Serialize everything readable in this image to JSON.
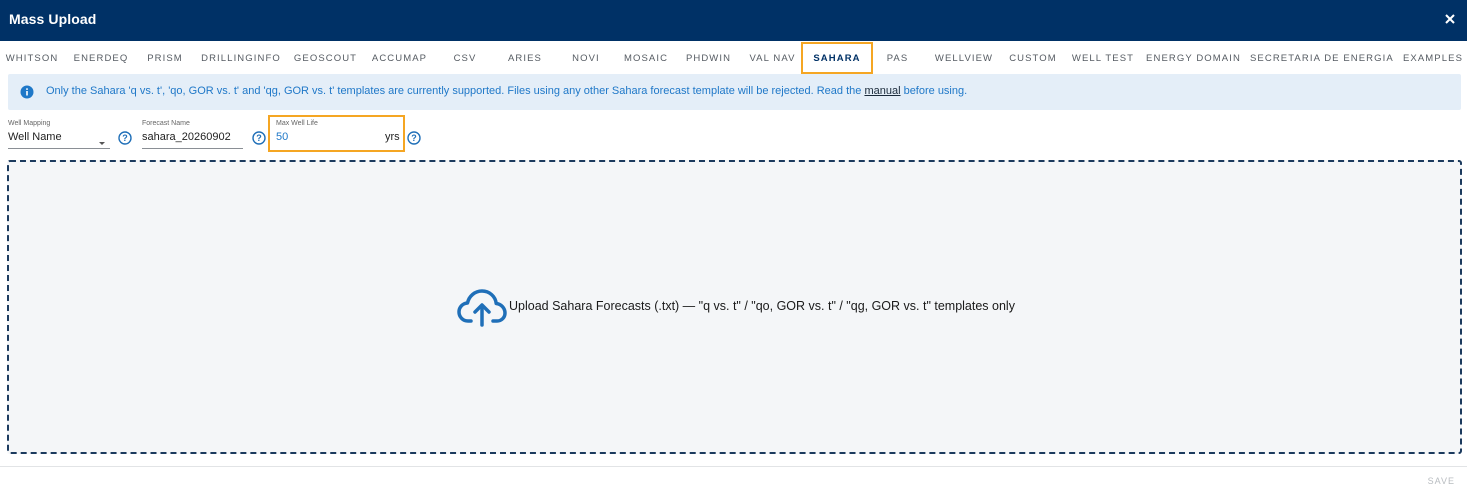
{
  "dialog": {
    "title": "Mass Upload"
  },
  "tabs": [
    {
      "label": "WHITSON"
    },
    {
      "label": "ENERDEQ"
    },
    {
      "label": "PRISM"
    },
    {
      "label": "DRILLINGINFO"
    },
    {
      "label": "GEOSCOUT"
    },
    {
      "label": "ACCUMAP"
    },
    {
      "label": "CSV"
    },
    {
      "label": "ARIES"
    },
    {
      "label": "NOVI"
    },
    {
      "label": "MOSAIC"
    },
    {
      "label": "PHDWIN"
    },
    {
      "label": "VAL NAV"
    },
    {
      "label": "SAHARA"
    },
    {
      "label": "PAS"
    },
    {
      "label": "WELLVIEW"
    },
    {
      "label": "CUSTOM"
    },
    {
      "label": "WELL TEST"
    },
    {
      "label": "ENERGY DOMAIN"
    },
    {
      "label": "SECRETARIA DE ENERGIA"
    },
    {
      "label": "EXAMPLES"
    }
  ],
  "active_tab": "SAHARA",
  "banner": {
    "text_before": "Only the Sahara 'q vs. t', 'qo, GOR vs. t' and 'qg, GOR vs. t' templates are currently supported. Files using any other Sahara forecast template will be rejected. Read the ",
    "link": "manual",
    "text_after": " before using."
  },
  "form": {
    "well_mapping": {
      "label": "Well Mapping",
      "value": "Well Name"
    },
    "forecast_name": {
      "label": "Forecast Name",
      "value": "sahara_20260902"
    },
    "max_well_life": {
      "label": "Max Well Life",
      "value": "50",
      "unit": "yrs"
    }
  },
  "dropzone": {
    "text": "Upload Sahara Forecasts (.txt) — \"q vs. t\" / \"qo, GOR vs. t\" / \"qg, GOR vs. t\" templates only"
  },
  "footer": {
    "save_label": "SAVE"
  },
  "colors": {
    "header_bg": "#003166",
    "highlight": "#f5a623",
    "info_text": "#1f78c8",
    "banner_bg": "#e4eef8",
    "upload_icon": "#1f6fb8"
  }
}
